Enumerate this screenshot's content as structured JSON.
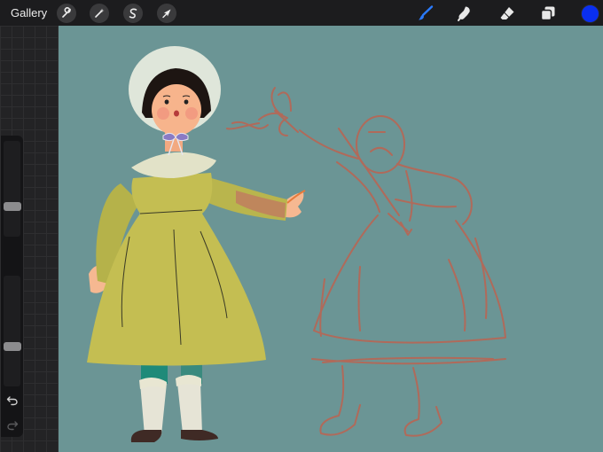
{
  "topbar": {
    "gallery_label": "Gallery",
    "left_tools": [
      {
        "name": "actions",
        "icon": "wrench-icon"
      },
      {
        "name": "adjustments",
        "icon": "magic-wand-icon"
      },
      {
        "name": "selection",
        "icon": "selection-s-icon"
      },
      {
        "name": "transform",
        "icon": "arrow-cursor-icon"
      }
    ],
    "right_tools": [
      {
        "name": "brush",
        "icon": "brush-icon",
        "active": true
      },
      {
        "name": "smudge",
        "icon": "smudge-finger-icon",
        "active": false
      },
      {
        "name": "eraser",
        "icon": "eraser-icon",
        "active": false
      },
      {
        "name": "layers",
        "icon": "layers-icon",
        "active": false
      }
    ],
    "current_color": "#0a2ff0"
  },
  "sidebar": {
    "brush_size_level": 0.3,
    "opacity_level": 0.35,
    "undo_icon": "undo-icon",
    "redo_icon": "redo-icon"
  },
  "canvas": {
    "background_color": "#6b9595",
    "sketch_color": "#b06a5a"
  }
}
